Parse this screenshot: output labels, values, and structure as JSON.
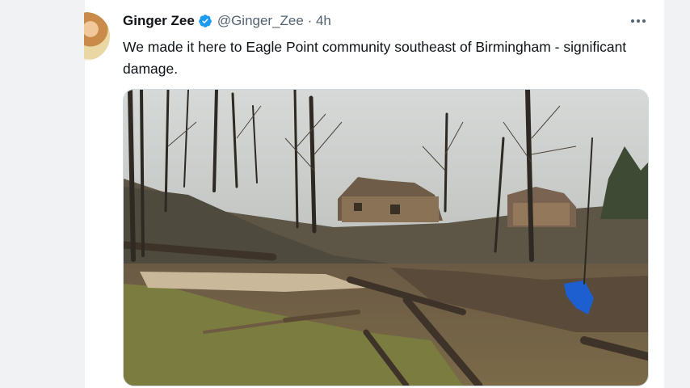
{
  "tweet": {
    "author_name": "Ginger Zee",
    "handle": "@Ginger_Zee",
    "separator": " · ",
    "timestamp": "4h",
    "text": "We made it here to Eagle Point community southeast of Birmingham - significant damage."
  },
  "icons": {
    "verified": "verified-badge-icon",
    "more": "more-options-icon"
  },
  "colors": {
    "verified_blue": "#1d9bf0",
    "text_primary": "#0f1419",
    "text_secondary": "#536471",
    "gutter": "#f1f2f3"
  }
}
